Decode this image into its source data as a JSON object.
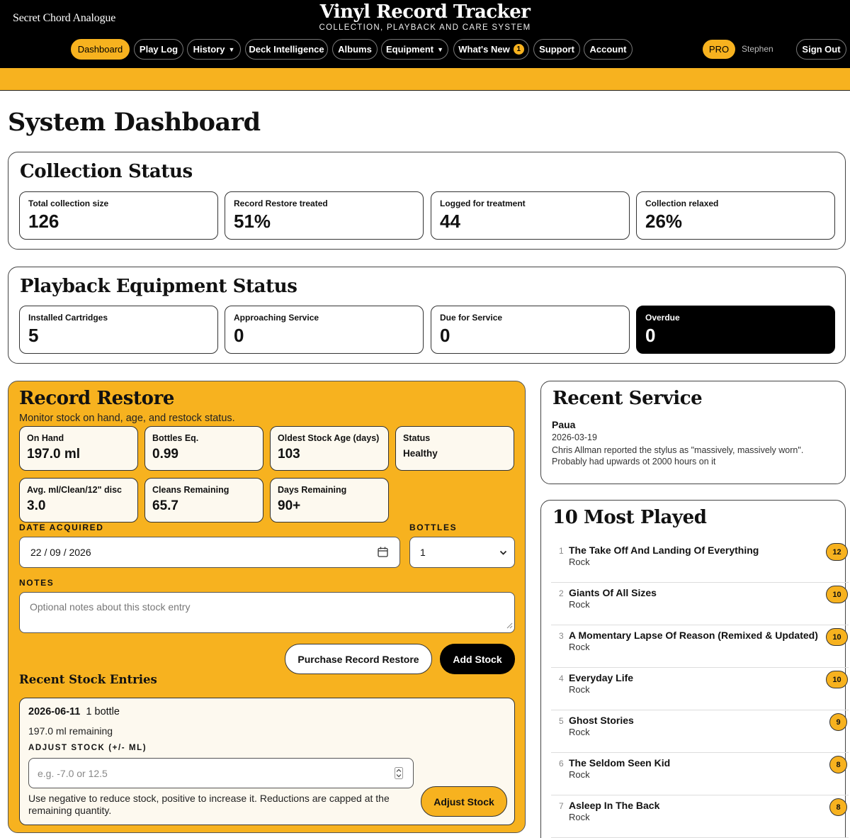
{
  "header": {
    "brand": "Secret Chord Analogue",
    "title": "Vinyl Record Tracker",
    "subtitle": "COLLECTION, PLAYBACK AND CARE SYSTEM",
    "nav": [
      {
        "label": "Dashboard",
        "active": true
      },
      {
        "label": "Play Log"
      },
      {
        "label": "History",
        "caret": "▼"
      },
      {
        "label": "Deck Intelligence"
      },
      {
        "label": "Albums"
      },
      {
        "label": "Equipment",
        "caret": "▼"
      },
      {
        "label": "What's New",
        "badge": "1"
      },
      {
        "label": "Support"
      },
      {
        "label": "Account"
      }
    ],
    "plan_badge": "PRO",
    "user_name": "Stephen",
    "sign_out": "Sign Out"
  },
  "page_title": "System Dashboard",
  "collection_status": {
    "title": "Collection Status",
    "cards": [
      {
        "label": "Total collection size",
        "value": "126"
      },
      {
        "label": "Record Restore treated",
        "value": "51%"
      },
      {
        "label": "Logged for treatment",
        "value": "44"
      },
      {
        "label": "Collection relaxed",
        "value": "26%"
      }
    ]
  },
  "equipment_status": {
    "title": "Playback Equipment Status",
    "cards": [
      {
        "label": "Installed Cartridges",
        "value": "5"
      },
      {
        "label": "Approaching Service",
        "value": "0"
      },
      {
        "label": "Due for Service",
        "value": "0"
      },
      {
        "label": "Overdue",
        "value": "0"
      }
    ]
  },
  "record_restore": {
    "title": "Record Restore",
    "description": "Monitor stock on hand, age, and restock status.",
    "stats": [
      {
        "label": "On Hand",
        "value": "197.0 ml"
      },
      {
        "label": "Bottles Eq.",
        "value": "0.99"
      },
      {
        "label": "Oldest Stock Age (days)",
        "value": "103"
      },
      {
        "label": "Status",
        "value": "Healthy"
      },
      {
        "label": "Avg. ml/Clean/12\" disc",
        "value": "3.0"
      },
      {
        "label": "Cleans Remaining",
        "value": "65.7"
      },
      {
        "label": "Days Remaining",
        "value": "90+"
      }
    ],
    "date_label": "DATE ACQUIRED",
    "date_value": "22 / 09 / 2026",
    "bottles_label": "BOTTLES",
    "bottles_value": "1",
    "notes_label": "NOTES",
    "notes_placeholder": "Optional notes about this stock entry",
    "purchase_button": "Purchase Record Restore",
    "add_button": "Add Stock",
    "recent_title": "Recent Stock Entries",
    "entry": {
      "date": "2026-06-11",
      "bottles": "1 bottle",
      "remaining": "197.0 ml remaining",
      "adjust_label": "ADJUST STOCK (+/- ML)",
      "adjust_placeholder": "e.g. -7.0 or 12.5",
      "help": "Use negative to reduce stock, positive to increase it. Reductions are capped at the remaining quantity.",
      "adjust_button": "Adjust Stock"
    }
  },
  "recent_service": {
    "title": "Recent Service",
    "item_name": "Paua",
    "date": "2026-03-19",
    "note": "Chris Allman reported the stylus as \"massively, massively worn\". Probably had upwards ot 2000 hours on it"
  },
  "most_played": {
    "title": "10 Most Played",
    "items": [
      {
        "rank": "1",
        "title": "The Take Off And Landing Of Everything",
        "genre": "Rock",
        "count": "12"
      },
      {
        "rank": "2",
        "title": "Giants Of All Sizes",
        "genre": "Rock",
        "count": "10"
      },
      {
        "rank": "3",
        "title": "A Momentary Lapse Of Reason (Remixed & Updated)",
        "genre": "Rock",
        "count": "10"
      },
      {
        "rank": "4",
        "title": "Everyday Life",
        "genre": "Rock",
        "count": "10"
      },
      {
        "rank": "5",
        "title": "Ghost Stories",
        "genre": "Rock",
        "count": "9"
      },
      {
        "rank": "6",
        "title": "The Seldom Seen Kid",
        "genre": "Rock",
        "count": "8"
      },
      {
        "rank": "7",
        "title": "Asleep In The Back",
        "genre": "Rock",
        "count": "8"
      }
    ]
  },
  "colors": {
    "accent": "#f7b21f",
    "header": "#000000",
    "panel_border": "#444444"
  }
}
